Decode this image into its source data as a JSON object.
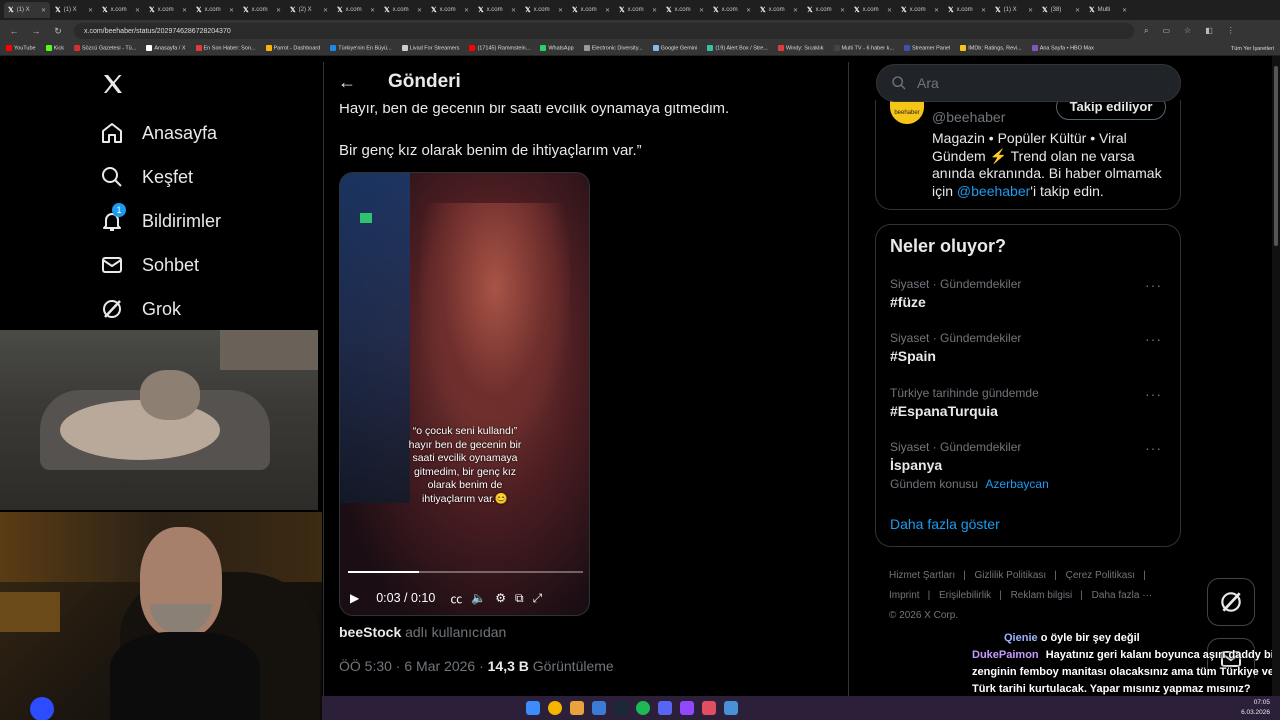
{
  "browser": {
    "tabs": [
      {
        "label": "(1) X"
      },
      {
        "label": "(1) X"
      },
      {
        "label": "x.com"
      },
      {
        "label": "x.com"
      },
      {
        "label": "x.com"
      },
      {
        "label": "x.com"
      },
      {
        "label": "(2) X"
      },
      {
        "label": "x.com"
      },
      {
        "label": "x.com"
      },
      {
        "label": "x.com"
      },
      {
        "label": "x.com"
      },
      {
        "label": "x.com"
      },
      {
        "label": "x.com"
      },
      {
        "label": "x.com"
      },
      {
        "label": "x.com"
      },
      {
        "label": "x.com"
      },
      {
        "label": "x.com"
      },
      {
        "label": "x.com"
      },
      {
        "label": "x.com"
      },
      {
        "label": "x.com"
      },
      {
        "label": "x.com"
      },
      {
        "label": "(1) X"
      },
      {
        "label": "(38)"
      },
      {
        "label": "Multi"
      }
    ],
    "url": "x.com/beehaber/status/2029746286728204370",
    "bookmarks": [
      {
        "label": "YouTube",
        "color": "#ff0000"
      },
      {
        "label": "Kick",
        "color": "#53fc18"
      },
      {
        "label": "Sözcü Gazetesi - Tü...",
        "color": "#d32f2f"
      },
      {
        "label": "Anasayfa / X",
        "color": "#ffffff"
      },
      {
        "label": "En Son Haber: Son...",
        "color": "#e53935"
      },
      {
        "label": "Parrot - Dashboard",
        "color": "#ffb300"
      },
      {
        "label": "Türkiye'nin En Büyü...",
        "color": "#1e88e5"
      },
      {
        "label": "Livad For Streamers",
        "color": "#cccccc"
      },
      {
        "label": "(17145) Rammstein...",
        "color": "#ff0000"
      },
      {
        "label": "WhatsApp",
        "color": "#25d366"
      },
      {
        "label": "Electronic Diversity...",
        "color": "#999999"
      },
      {
        "label": "Google Gemini",
        "color": "#8ab4f8"
      },
      {
        "label": "(19) Alert Box / Stre...",
        "color": "#31c3a2"
      },
      {
        "label": "Windy: Sıcaklık",
        "color": "#e53935"
      },
      {
        "label": "Multi TV - 6 haber k...",
        "color": "#444444"
      },
      {
        "label": "Streamer Panel",
        "color": "#3f51b5"
      },
      {
        "label": "IMDb: Ratings, Revi...",
        "color": "#f5c518"
      },
      {
        "label": "Ana Sayfa • HBO Max",
        "color": "#7e57c2"
      }
    ],
    "bookmarks_end": "Tüm Yer İşaretleri"
  },
  "nav": {
    "items": [
      {
        "label": "Anasayfa",
        "icon": "home-icon"
      },
      {
        "label": "Keşfet",
        "icon": "search-icon"
      },
      {
        "label": "Bildirimler",
        "icon": "bell-icon",
        "badge": "1"
      },
      {
        "label": "Sohbet",
        "icon": "mail-icon"
      },
      {
        "label": "Grok",
        "icon": "grok-icon"
      }
    ]
  },
  "post": {
    "header_title": "Gönderi",
    "text_line1": "Hayır, ben de gecenin bir saati evcilik oynamaya gitmedim.",
    "text_line2": "Bir genç kız olarak benim de ihtiyaçlarım var.”",
    "video": {
      "caption": "“o çocuk seni kullandı” hayır ben de gecenin bir saati evcilik oynamaya gitmedim, bir genç kız olarak benim de ihtiyaçlarım var.😊",
      "time": "0:03 / 0:10",
      "progress": 0.3
    },
    "attribution_user": "beeStock",
    "attribution_rest": "adlı kullanıcıdan",
    "meta_time": "ÖÖ 5:30 · 6 Mar 2026 · ",
    "views_count": "14,3 B",
    "views_label": "Görüntüleme"
  },
  "sidebar": {
    "search_placeholder": "Ara",
    "profile": {
      "handle": "@beehaber",
      "follow_label": "Takip ediliyor",
      "avatar_text": "beehaber",
      "bio_part1": "Magazin • Popüler Kültür • Viral Gündem ⚡ Trend olan ne varsa anında ekranında. Bi haber olmamak için ",
      "bio_mention": "@beehaber",
      "bio_part2": "'i takip edin."
    },
    "trends_title": "Neler oluyor?",
    "trends": [
      {
        "context": "Siyaset · Gündemdekiler",
        "name": "#füze"
      },
      {
        "context": "Siyaset · Gündemdekiler",
        "name": "#Spain"
      },
      {
        "context": "Türkiye tarihinde gündemde",
        "name": "#EspanaTurquia"
      },
      {
        "context": "Siyaset · Gündemdekiler",
        "name": "İspanya",
        "extra_label": "Gündem konusu",
        "extra_link": "Azerbaycan"
      }
    ],
    "show_more": "Daha fazla göster",
    "footer": [
      "Hizmet Şartları",
      "Gizlilik Politikası",
      "Çerez Politikası",
      "Imprint",
      "Erişilebilirlik",
      "Reklam bilgisi",
      "Daha fazla ···"
    ],
    "copyright": "© 2026 X Corp."
  },
  "chat": [
    {
      "user": "Qienie",
      "message": "o öyle bir şey değil"
    },
    {
      "user": "DukePaimon",
      "message": "Hayatınız geri kalanı boyunca aşırı daddy bir zenginin femboy manitası olacaksınız ama tüm Türkiye ve Türk tarihi kurtulacak. Yapar mısınız yapmaz mısınız?"
    }
  ],
  "taskbar": {
    "time": "07:05",
    "date": "6.03.2026"
  }
}
